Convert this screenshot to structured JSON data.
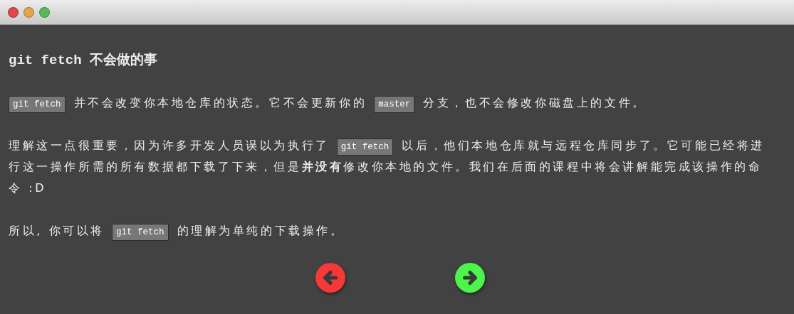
{
  "window": {
    "controls": [
      {
        "color": "#e0474c"
      },
      {
        "color": "#e0a64a"
      },
      {
        "color": "#5cb85c"
      }
    ]
  },
  "title": "git fetch 不会做的事",
  "paragraphs": [
    [
      {
        "kind": "code",
        "text": "git fetch"
      },
      {
        "kind": "text",
        "text": "并不会改变你本地仓库的状态。它不会更新你的"
      },
      {
        "kind": "code",
        "text": "master"
      },
      {
        "kind": "text",
        "text": "分支，也不会修改你磁盘上的文件。"
      }
    ],
    [
      {
        "kind": "text",
        "text": "理解这一点很重要，因为许多开发人员误以为执行了"
      },
      {
        "kind": "code",
        "text": "git fetch"
      },
      {
        "kind": "text",
        "text": "以后，他们本地仓库就与远程仓库同步了。它可能已经将进"
      },
      {
        "kind": "text",
        "text": "行这一操作所需的所有数据都下载了下来，但是**并没有**修改你本地的文件。我们在后面的课程中将会讲解能完成该操作的命"
      },
      {
        "kind": "text",
        "text": "令 :D"
      }
    ],
    [
      {
        "kind": "text",
        "text": "所以, 你可以将"
      },
      {
        "kind": "code",
        "text": "git fetch"
      },
      {
        "kind": "text",
        "text": "的理解为单纯的下载操作。"
      }
    ]
  ],
  "nav": [
    {
      "kind": "back",
      "color": "#f53838"
    },
    {
      "kind": "forward",
      "color": "#4cf54c"
    }
  ]
}
